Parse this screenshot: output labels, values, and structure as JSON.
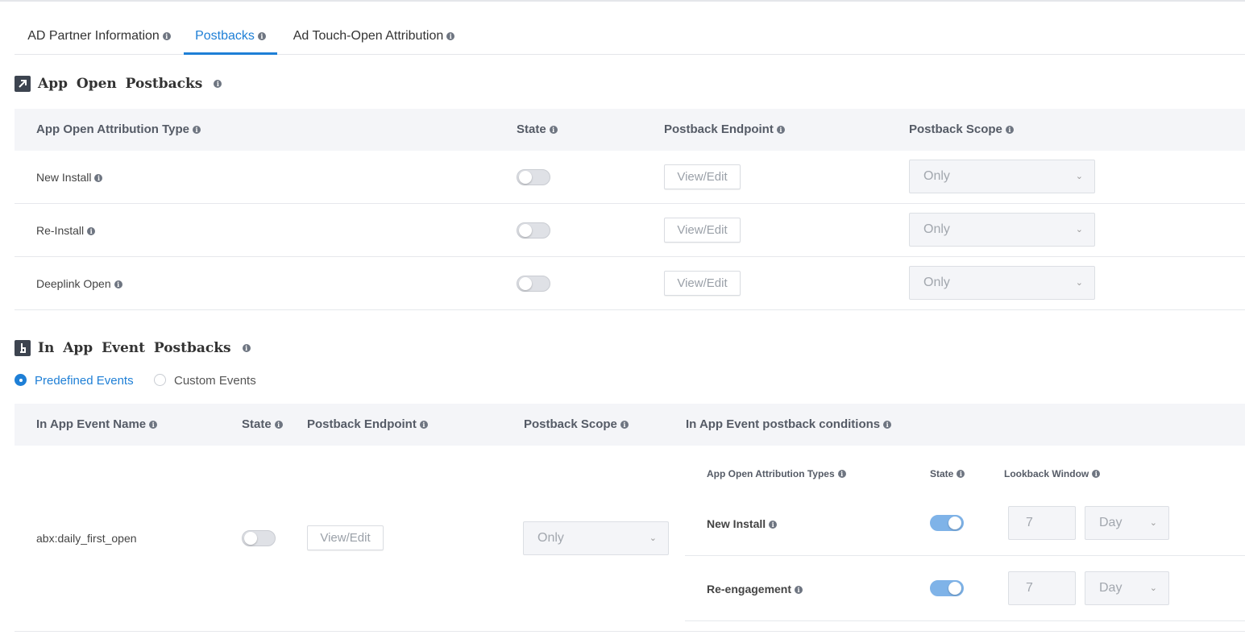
{
  "tabs": [
    {
      "label": "AD Partner Information",
      "active": false
    },
    {
      "label": "Postbacks",
      "active": true
    },
    {
      "label": "Ad Touch-Open Attribution",
      "active": false
    }
  ],
  "app_open": {
    "title": "App Open Postbacks",
    "icon": "arrow-up-right-icon",
    "headers": {
      "type": "App Open Attribution Type",
      "state": "State",
      "endpoint": "Postback Endpoint",
      "scope": "Postback Scope"
    },
    "rows": [
      {
        "label": "New Install",
        "state": false,
        "button": "View/Edit",
        "scope": "Only"
      },
      {
        "label": "Re-Install",
        "state": false,
        "button": "View/Edit",
        "scope": "Only"
      },
      {
        "label": "Deeplink Open",
        "state": false,
        "button": "View/Edit",
        "scope": "Only"
      }
    ]
  },
  "in_app": {
    "title": "In App Event Postbacks",
    "icon": "touch-icon",
    "radios": [
      {
        "label": "Predefined Events",
        "selected": true
      },
      {
        "label": "Custom Events",
        "selected": false
      }
    ],
    "headers": {
      "name": "In App Event Name",
      "state": "State",
      "endpoint": "Postback Endpoint",
      "scope": "Postback Scope",
      "conditions": "In App Event postback conditions"
    },
    "row": {
      "name": "abx:daily_first_open",
      "state": false,
      "button": "View/Edit",
      "scope": "Only",
      "sub_headers": {
        "types": "App Open Attribution Types",
        "state": "State",
        "lookback": "Lookback Window"
      },
      "conditions": [
        {
          "label": "New Install",
          "state": true,
          "value": "7",
          "unit": "Day"
        },
        {
          "label": "Re-engagement",
          "state": true,
          "value": "7",
          "unit": "Day"
        }
      ]
    }
  },
  "colors": {
    "accent": "#1e7fd6",
    "toggle_on": "#7fb3e8",
    "header_bg": "#f4f5f8"
  }
}
